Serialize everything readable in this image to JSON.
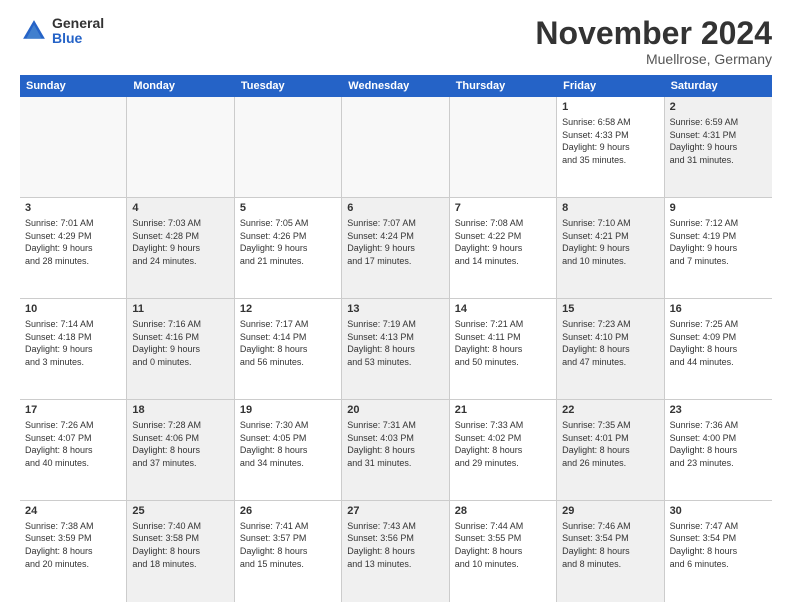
{
  "header": {
    "logo_general": "General",
    "logo_blue": "Blue",
    "month_title": "November 2024",
    "location": "Muellrose, Germany"
  },
  "weekdays": [
    "Sunday",
    "Monday",
    "Tuesday",
    "Wednesday",
    "Thursday",
    "Friday",
    "Saturday"
  ],
  "weeks": [
    [
      {
        "day": "",
        "info": "",
        "shaded": false,
        "empty": true
      },
      {
        "day": "",
        "info": "",
        "shaded": false,
        "empty": true
      },
      {
        "day": "",
        "info": "",
        "shaded": false,
        "empty": true
      },
      {
        "day": "",
        "info": "",
        "shaded": false,
        "empty": true
      },
      {
        "day": "",
        "info": "",
        "shaded": false,
        "empty": true
      },
      {
        "day": "1",
        "info": "Sunrise: 6:58 AM\nSunset: 4:33 PM\nDaylight: 9 hours\nand 35 minutes.",
        "shaded": false,
        "empty": false
      },
      {
        "day": "2",
        "info": "Sunrise: 6:59 AM\nSunset: 4:31 PM\nDaylight: 9 hours\nand 31 minutes.",
        "shaded": true,
        "empty": false
      }
    ],
    [
      {
        "day": "3",
        "info": "Sunrise: 7:01 AM\nSunset: 4:29 PM\nDaylight: 9 hours\nand 28 minutes.",
        "shaded": false,
        "empty": false
      },
      {
        "day": "4",
        "info": "Sunrise: 7:03 AM\nSunset: 4:28 PM\nDaylight: 9 hours\nand 24 minutes.",
        "shaded": true,
        "empty": false
      },
      {
        "day": "5",
        "info": "Sunrise: 7:05 AM\nSunset: 4:26 PM\nDaylight: 9 hours\nand 21 minutes.",
        "shaded": false,
        "empty": false
      },
      {
        "day": "6",
        "info": "Sunrise: 7:07 AM\nSunset: 4:24 PM\nDaylight: 9 hours\nand 17 minutes.",
        "shaded": true,
        "empty": false
      },
      {
        "day": "7",
        "info": "Sunrise: 7:08 AM\nSunset: 4:22 PM\nDaylight: 9 hours\nand 14 minutes.",
        "shaded": false,
        "empty": false
      },
      {
        "day": "8",
        "info": "Sunrise: 7:10 AM\nSunset: 4:21 PM\nDaylight: 9 hours\nand 10 minutes.",
        "shaded": true,
        "empty": false
      },
      {
        "day": "9",
        "info": "Sunrise: 7:12 AM\nSunset: 4:19 PM\nDaylight: 9 hours\nand 7 minutes.",
        "shaded": false,
        "empty": false
      }
    ],
    [
      {
        "day": "10",
        "info": "Sunrise: 7:14 AM\nSunset: 4:18 PM\nDaylight: 9 hours\nand 3 minutes.",
        "shaded": false,
        "empty": false
      },
      {
        "day": "11",
        "info": "Sunrise: 7:16 AM\nSunset: 4:16 PM\nDaylight: 9 hours\nand 0 minutes.",
        "shaded": true,
        "empty": false
      },
      {
        "day": "12",
        "info": "Sunrise: 7:17 AM\nSunset: 4:14 PM\nDaylight: 8 hours\nand 56 minutes.",
        "shaded": false,
        "empty": false
      },
      {
        "day": "13",
        "info": "Sunrise: 7:19 AM\nSunset: 4:13 PM\nDaylight: 8 hours\nand 53 minutes.",
        "shaded": true,
        "empty": false
      },
      {
        "day": "14",
        "info": "Sunrise: 7:21 AM\nSunset: 4:11 PM\nDaylight: 8 hours\nand 50 minutes.",
        "shaded": false,
        "empty": false
      },
      {
        "day": "15",
        "info": "Sunrise: 7:23 AM\nSunset: 4:10 PM\nDaylight: 8 hours\nand 47 minutes.",
        "shaded": true,
        "empty": false
      },
      {
        "day": "16",
        "info": "Sunrise: 7:25 AM\nSunset: 4:09 PM\nDaylight: 8 hours\nand 44 minutes.",
        "shaded": false,
        "empty": false
      }
    ],
    [
      {
        "day": "17",
        "info": "Sunrise: 7:26 AM\nSunset: 4:07 PM\nDaylight: 8 hours\nand 40 minutes.",
        "shaded": false,
        "empty": false
      },
      {
        "day": "18",
        "info": "Sunrise: 7:28 AM\nSunset: 4:06 PM\nDaylight: 8 hours\nand 37 minutes.",
        "shaded": true,
        "empty": false
      },
      {
        "day": "19",
        "info": "Sunrise: 7:30 AM\nSunset: 4:05 PM\nDaylight: 8 hours\nand 34 minutes.",
        "shaded": false,
        "empty": false
      },
      {
        "day": "20",
        "info": "Sunrise: 7:31 AM\nSunset: 4:03 PM\nDaylight: 8 hours\nand 31 minutes.",
        "shaded": true,
        "empty": false
      },
      {
        "day": "21",
        "info": "Sunrise: 7:33 AM\nSunset: 4:02 PM\nDaylight: 8 hours\nand 29 minutes.",
        "shaded": false,
        "empty": false
      },
      {
        "day": "22",
        "info": "Sunrise: 7:35 AM\nSunset: 4:01 PM\nDaylight: 8 hours\nand 26 minutes.",
        "shaded": true,
        "empty": false
      },
      {
        "day": "23",
        "info": "Sunrise: 7:36 AM\nSunset: 4:00 PM\nDaylight: 8 hours\nand 23 minutes.",
        "shaded": false,
        "empty": false
      }
    ],
    [
      {
        "day": "24",
        "info": "Sunrise: 7:38 AM\nSunset: 3:59 PM\nDaylight: 8 hours\nand 20 minutes.",
        "shaded": false,
        "empty": false
      },
      {
        "day": "25",
        "info": "Sunrise: 7:40 AM\nSunset: 3:58 PM\nDaylight: 8 hours\nand 18 minutes.",
        "shaded": true,
        "empty": false
      },
      {
        "day": "26",
        "info": "Sunrise: 7:41 AM\nSunset: 3:57 PM\nDaylight: 8 hours\nand 15 minutes.",
        "shaded": false,
        "empty": false
      },
      {
        "day": "27",
        "info": "Sunrise: 7:43 AM\nSunset: 3:56 PM\nDaylight: 8 hours\nand 13 minutes.",
        "shaded": true,
        "empty": false
      },
      {
        "day": "28",
        "info": "Sunrise: 7:44 AM\nSunset: 3:55 PM\nDaylight: 8 hours\nand 10 minutes.",
        "shaded": false,
        "empty": false
      },
      {
        "day": "29",
        "info": "Sunrise: 7:46 AM\nSunset: 3:54 PM\nDaylight: 8 hours\nand 8 minutes.",
        "shaded": true,
        "empty": false
      },
      {
        "day": "30",
        "info": "Sunrise: 7:47 AM\nSunset: 3:54 PM\nDaylight: 8 hours\nand 6 minutes.",
        "shaded": false,
        "empty": false
      }
    ]
  ]
}
